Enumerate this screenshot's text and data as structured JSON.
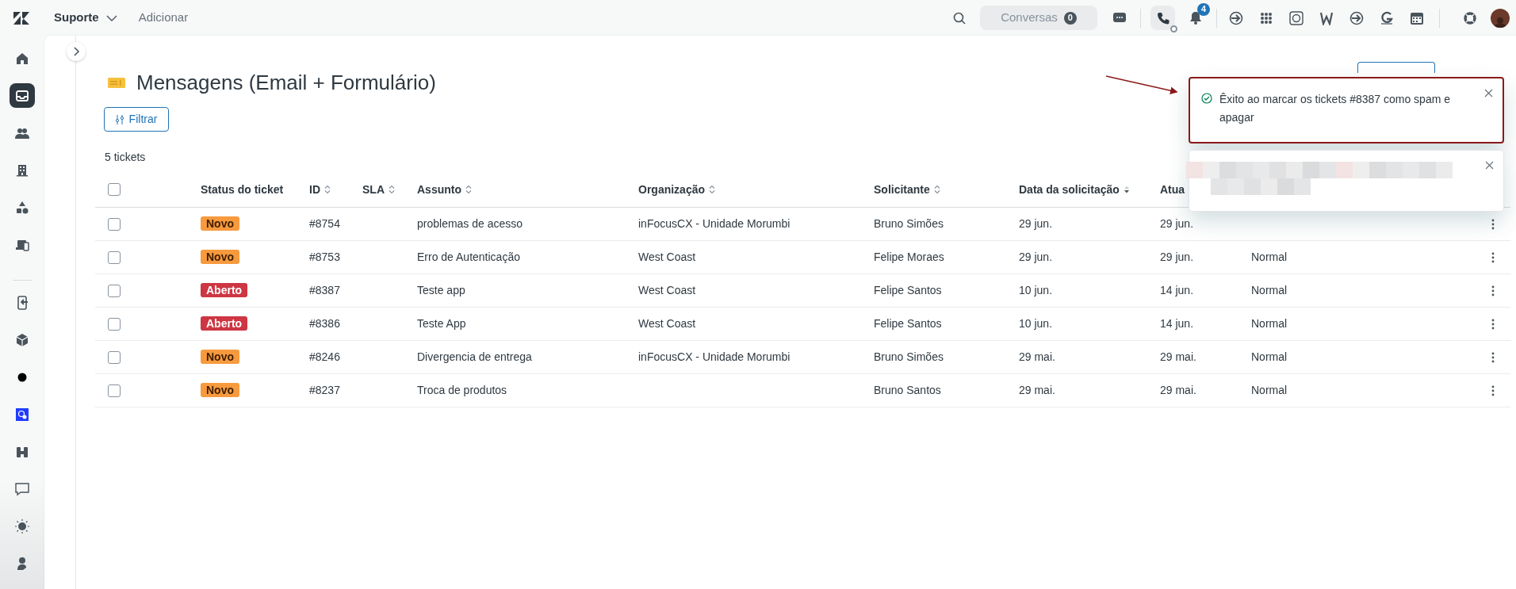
{
  "topbar": {
    "product": "Suporte",
    "add_link": "Adicionar",
    "conversations": {
      "label": "Conversas",
      "count": "0"
    },
    "phone_active": true,
    "notifications_count": "4"
  },
  "sidebar": {
    "groups": [
      [
        {
          "selected": false
        },
        {
          "selected": true
        },
        {
          "selected": false
        },
        {
          "selected": false
        },
        {
          "selected": false
        },
        {
          "selected": false
        }
      ],
      [
        {
          "selected": false
        },
        {
          "selected": false
        },
        {
          "selected": false
        },
        {
          "selected": false
        },
        {
          "selected": false
        },
        {
          "selected": false
        },
        {
          "selected": false
        },
        {
          "selected": false
        }
      ]
    ]
  },
  "view": {
    "title": "Mensagens (Email + Formulário)",
    "filter_button": "Filtrar",
    "count": "5 tickets"
  },
  "table": {
    "header_checked": false,
    "columns": [
      {
        "label": "Status do ticket",
        "sortable": false,
        "sorted_descending": false
      },
      {
        "label": "ID",
        "sortable": true,
        "sorted_descending": false
      },
      {
        "label": "SLA",
        "sortable": true,
        "sorted_descending": false
      },
      {
        "label": "Assunto",
        "sortable": true,
        "sorted_descending": false
      },
      {
        "label": "Organização",
        "sortable": true,
        "sorted_descending": false
      },
      {
        "label": "Solicitante",
        "sortable": true,
        "sorted_descending": false
      },
      {
        "label": "Data da solicitação",
        "sortable": true,
        "sorted_descending": true
      },
      {
        "label": "Atua",
        "sortable": false,
        "sorted_descending": false
      }
    ],
    "rows": [
      {
        "checked": false,
        "status": {
          "label": "Novo",
          "kind": "new"
        },
        "id": "#8754",
        "subject": "problemas de acesso",
        "organization": "inFocusCX - Unidade Morumbi",
        "requester": "Bruno Simões",
        "requested": "29 jun.",
        "updated": "29 jun."
      },
      {
        "checked": false,
        "status": {
          "label": "Novo",
          "kind": "new"
        },
        "id": "#8753",
        "subject": "Erro de Autenticação",
        "organization": "West Coast",
        "requester": "Felipe Moraes",
        "requested": "29 jun.",
        "updated": "29 jun.",
        "priority": "Normal"
      },
      {
        "checked": false,
        "status": {
          "label": "Aberto",
          "kind": "open"
        },
        "id": "#8387",
        "subject": "Teste app",
        "organization": "West Coast",
        "requester": "Felipe Santos",
        "requested": "10 jun.",
        "updated": "14 jun.",
        "priority": "Normal"
      },
      {
        "checked": false,
        "status": {
          "label": "Aberto",
          "kind": "open"
        },
        "id": "#8386",
        "subject": "Teste App",
        "organization": "West Coast",
        "requester": "Felipe Santos",
        "requested": "10 jun.",
        "updated": "14 jun.",
        "priority": "Normal"
      },
      {
        "checked": false,
        "status": {
          "label": "Novo",
          "kind": "new"
        },
        "id": "#8246",
        "subject": "Divergencia de entrega",
        "organization": "inFocusCX - Unidade Morumbi",
        "requester": "Bruno Simões",
        "requested": "29 mai.",
        "updated": "29 mai.",
        "priority": "Normal"
      },
      {
        "checked": false,
        "status": {
          "label": "Novo",
          "kind": "new"
        },
        "id": "#8237",
        "subject": "Troca de produtos",
        "requester": "Bruno Santos",
        "requested": "29 mai.",
        "updated": "29 mai.",
        "priority": "Normal"
      }
    ]
  },
  "toasts": [
    {
      "kind": "success",
      "message": "Êxito ao marcar os tickets #8387 como spam e apagar"
    },
    {
      "kind": "redacted"
    }
  ]
}
